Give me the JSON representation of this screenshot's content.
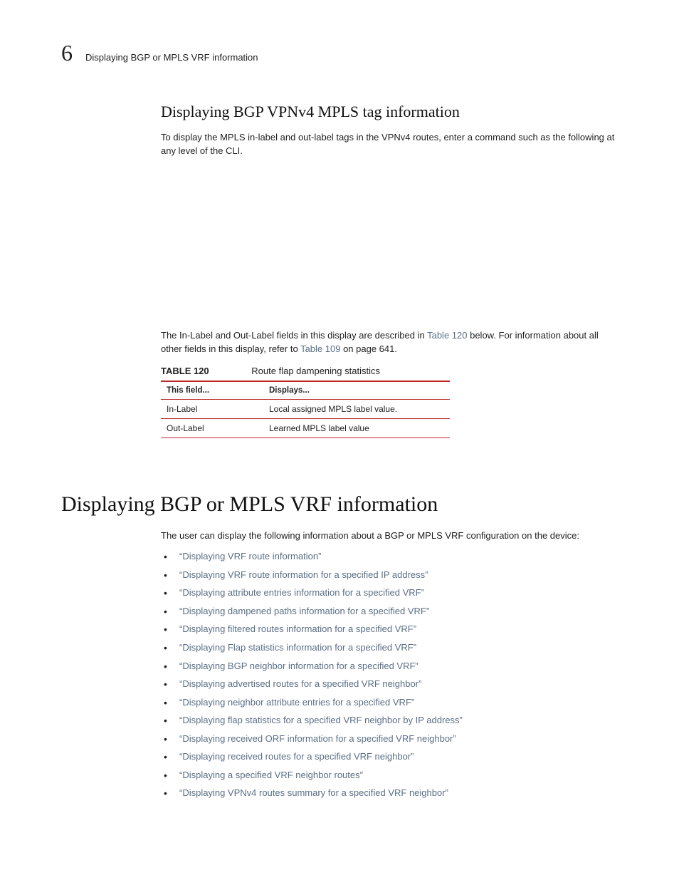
{
  "header": {
    "chapter_number": "6",
    "running_title": "Displaying BGP or MPLS VRF information"
  },
  "section1": {
    "heading": "Displaying BGP VPNv4 MPLS tag information",
    "intro": "To display the MPLS in-label and out-label tags in the VPNv4 routes, enter a command such as the following at any level of the CLI.",
    "para2_pre": "The In-Label and Out-Label fields in this display are described in ",
    "para2_link1": "Table 120",
    "para2_mid": " below. For information about all other fields in this display, refer to ",
    "para2_link2": "Table 109",
    "para2_post": " on page 641."
  },
  "table120": {
    "label": "TABLE 120",
    "title": "Route flap dampening statistics",
    "head_field": "This field...",
    "head_displays": "Displays...",
    "rows": [
      {
        "field": "In-Label",
        "displays": "Local assigned MPLS label value."
      },
      {
        "field": "Out-Label",
        "displays": "Learned MPLS label value"
      }
    ]
  },
  "section2": {
    "heading": "Displaying BGP or MPLS VRF information",
    "intro": "The user can display the following information about a BGP or MPLS VRF configuration on the device:",
    "links": [
      "“Displaying VRF route information”",
      "“Displaying VRF route information for a specified IP address”",
      "“Displaying attribute entries information for a specified VRF”",
      "“Displaying dampened paths information for a specified VRF”",
      "“Displaying filtered routes information for a specified VRF”",
      "“Displaying Flap statistics information for a specified VRF”",
      "“Displaying BGP neighbor information for a specified VRF”",
      "“Displaying advertised routes for a specified VRF neighbor”",
      "“Displaying neighbor attribute entries for a specified VRF”",
      "“Displaying flap statistics for a specified VRF neighbor by IP address”",
      "“Displaying received ORF information for a specified VRF neighbor”",
      "“Displaying received routes for a specified VRF neighbor”",
      "“Displaying a specified VRF neighbor routes”",
      "“Displaying VPNv4 routes summary for a specified VRF neighbor”"
    ]
  }
}
